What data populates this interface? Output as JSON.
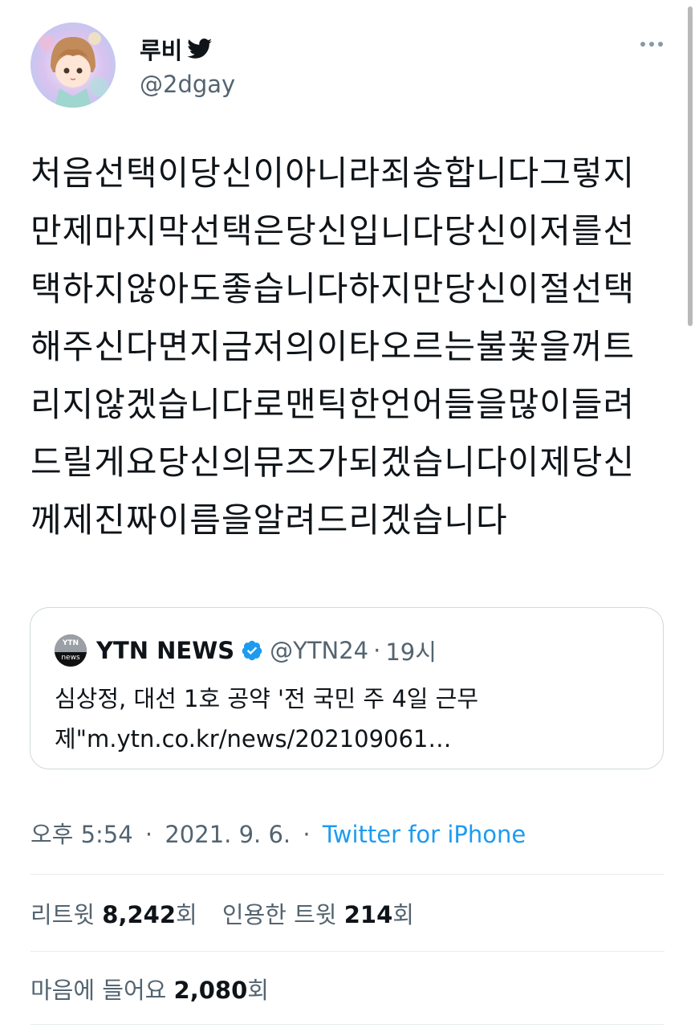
{
  "tweet": {
    "author": {
      "name": "루비",
      "handle": "@2dgay"
    },
    "text": "처음선택이당신이아니라죄송합니다그렇지만제마지막선택은당신입니다당신이저를선택하지않아도좋습니다하지만당신이절선택해주신다면지금저의이타오르는불꽃을꺼트리지않겠습니다로맨틱한언어들을많이들려드릴게요당신의뮤즈가되겠습니다이제당신께제진짜이름을알려드리겠습니다",
    "quoted": {
      "logo_top": "YTN",
      "logo_bottom": "news",
      "name": "YTN NEWS",
      "handle": "@YTN24",
      "separator": "·",
      "time": "19시",
      "line1": "심상정, 대선 1호 공약 '전 국민 주 4일 근무",
      "line2": "제\"m.ytn.co.kr/news/202109061…"
    },
    "meta": {
      "time": "오후 5:54",
      "dot1": "·",
      "date": "2021. 9. 6.",
      "dot2": "·",
      "source": "Twitter for iPhone"
    },
    "stats": {
      "retweets_label": "리트윗",
      "retweets_value": "8,242",
      "retweets_unit": "회",
      "quotes_label": "인용한 트윗",
      "quotes_value": "214",
      "quotes_unit": "회",
      "likes_label": "마음에 들어요",
      "likes_value": "2,080",
      "likes_unit": "회"
    }
  },
  "icons": {
    "bird": "twitter-bird-icon",
    "verified": "verified-badge-icon",
    "more": "more-options-icon"
  },
  "colors": {
    "accent": "#1d9bf0",
    "secondary_text": "#536471",
    "primary_text": "#0f1419",
    "border": "#cfd9de"
  }
}
